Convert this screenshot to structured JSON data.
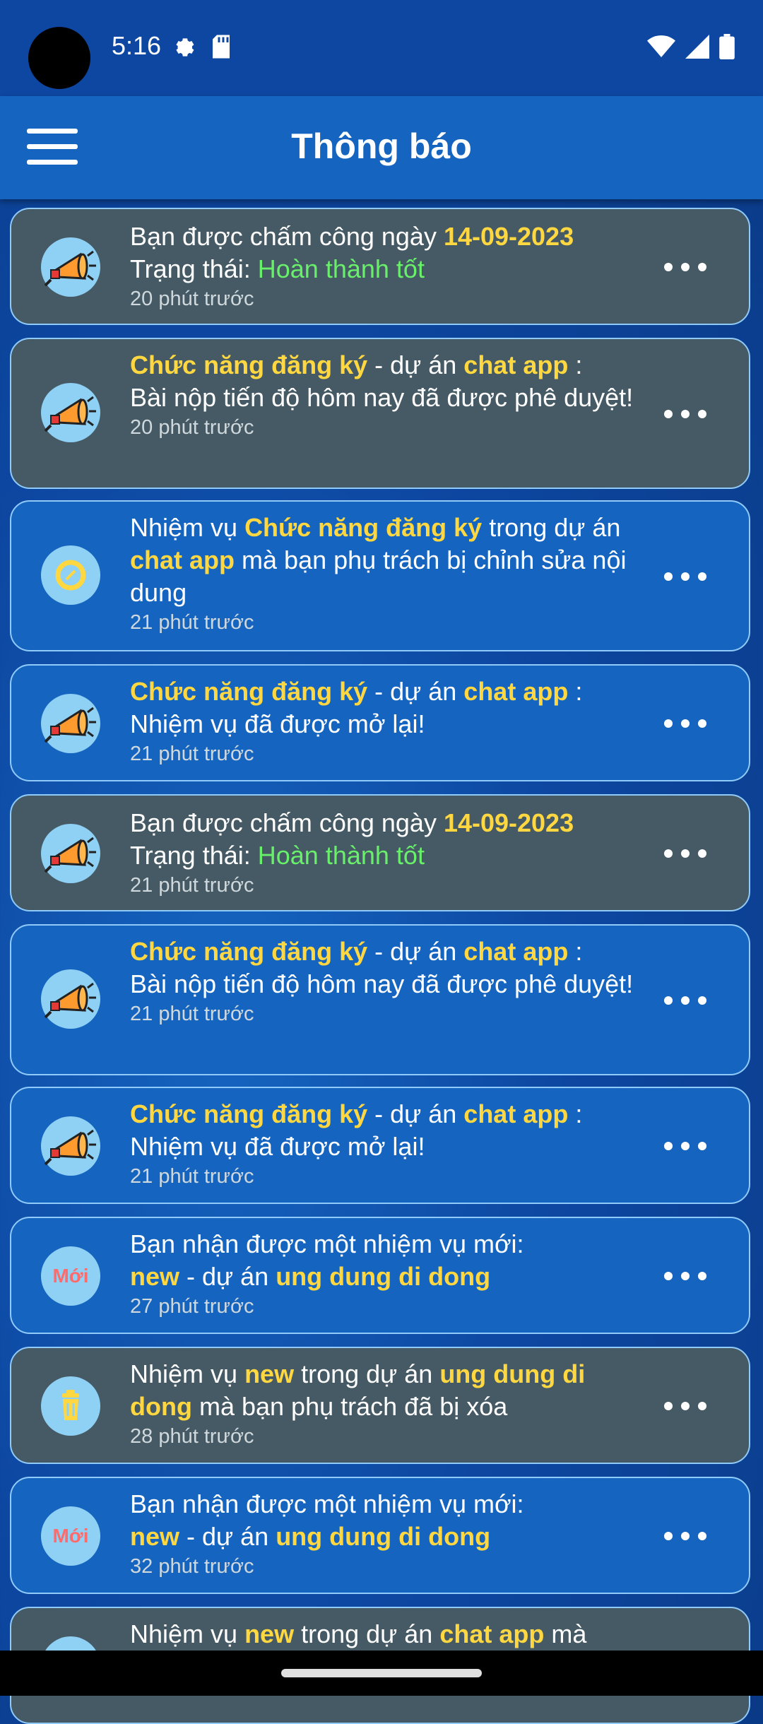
{
  "status_bar": {
    "time": "5:16",
    "icons": [
      "settings-icon",
      "sd-card-icon",
      "wifi-icon",
      "signal-icon",
      "battery-icon"
    ]
  },
  "app_bar": {
    "title": "Thông báo",
    "menu_icon": "hamburger-menu-icon"
  },
  "colors": {
    "highlight": "#ffd740",
    "success": "#69f06b",
    "card_read": "#455a64",
    "card_unread": "#1565c0",
    "card_border": "#90caf9"
  },
  "notifications": [
    {
      "style": "grey",
      "icon": "megaphone-icon",
      "l1": "Bạn được chấm công ngày ",
      "d1": "14-09-2023",
      "l2": "Trạng thái: ",
      "status": "Hoàn thành tốt",
      "time": "20 phút trước"
    },
    {
      "style": "grey",
      "icon": "megaphone-icon",
      "task": "Chức năng đăng ký",
      "sep": " - dự án ",
      "project": "chat app",
      "colon": " :",
      "msg": "Bài nộp tiến độ hôm nay đã được phê duyệt!",
      "time": "20 phút trước"
    },
    {
      "style": "blue",
      "icon": "edit-badge-icon",
      "a": "Nhiệm vụ ",
      "task": "Chức năng đăng ký",
      "b": " trong dự án ",
      "project": "chat app",
      "c": " mà bạn phụ trách bị chỉnh sửa nội dung",
      "time": "21 phút trước"
    },
    {
      "style": "blue",
      "icon": "megaphone-icon",
      "task": "Chức năng đăng ký",
      "sep": " - dự án ",
      "project": "chat app",
      "colon": " :",
      "msg": "Nhiệm vụ đã được mở lại!",
      "time": "21 phút trước"
    },
    {
      "style": "grey",
      "icon": "megaphone-icon",
      "l1": "Bạn được chấm công ngày ",
      "d1": "14-09-2023",
      "l2": "Trạng thái: ",
      "status": "Hoàn thành tốt",
      "time": "21 phút trước"
    },
    {
      "style": "blue",
      "icon": "megaphone-icon",
      "task": "Chức năng đăng ký",
      "sep": " - dự án ",
      "project": "chat app",
      "colon": " :",
      "msg": "Bài nộp tiến độ hôm nay đã được phê duyệt!",
      "time": "21 phút trước"
    },
    {
      "style": "blue",
      "icon": "megaphone-icon",
      "task": "Chức năng đăng ký",
      "sep": " - dự án ",
      "project": "chat app",
      "colon": " :",
      "msg": "Nhiệm vụ đã được mở lại!",
      "time": "21 phút trước"
    },
    {
      "style": "blue",
      "icon": "new-badge-icon",
      "badge": "Mới",
      "l1": "Bạn nhận được một nhiệm vụ mới:",
      "task": "new",
      "sep": " - dự án ",
      "project": "ung dung di dong",
      "time": "27 phút trước"
    },
    {
      "style": "grey",
      "icon": "trash-icon",
      "a": "Nhiệm vụ ",
      "task": "new",
      "b": " trong dự án ",
      "project": "ung dung di dong",
      "c": " mà bạn phụ trách đã bị xóa",
      "time": "28 phút trước"
    },
    {
      "style": "blue",
      "icon": "new-badge-icon",
      "badge": "Mới",
      "l1": "Bạn nhận được một nhiệm vụ mới:",
      "task": "new",
      "sep": " - dự án ",
      "project": "ung dung di dong",
      "time": "32 phút trước"
    },
    {
      "style": "grey",
      "icon": "edit-badge-icon",
      "a": "Nhiệm vụ ",
      "task": "new",
      "b": " trong dự án ",
      "project": "chat app",
      "c": " mà"
    }
  ]
}
